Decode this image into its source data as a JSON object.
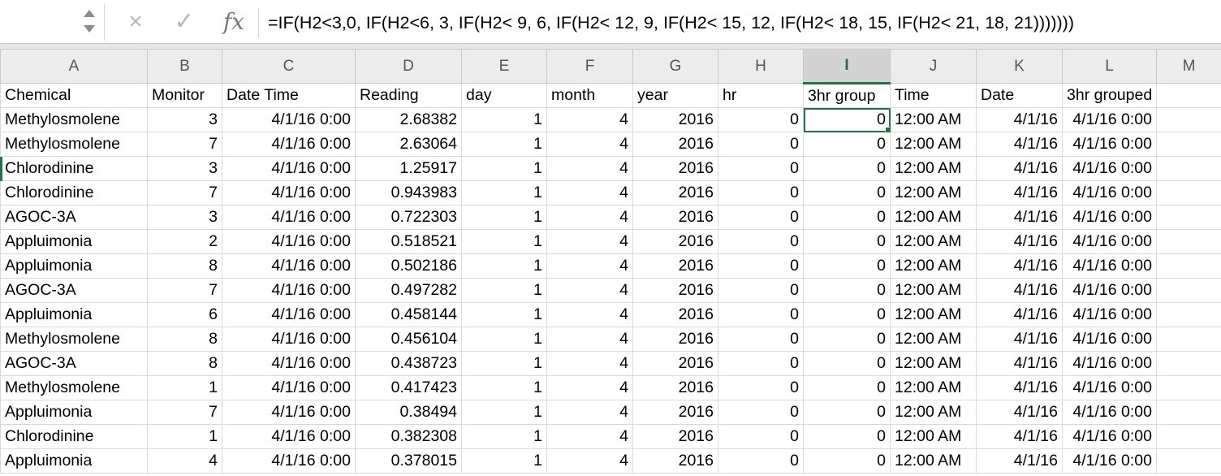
{
  "formula_bar": {
    "name_box": "",
    "formula": "=IF(H2<3,0, IF(H2<6, 3, IF(H2< 9, 6,  IF(H2< 12, 9,  IF(H2< 15, 12,  IF(H2< 18, 15,  IF(H2< 21, 18,  21)))))))",
    "cancel_icon": "×",
    "enter_icon": "✓",
    "fx_label": "fx"
  },
  "columns": [
    "A",
    "B",
    "C",
    "D",
    "E",
    "F",
    "G",
    "H",
    "I",
    "J",
    "K",
    "L",
    "M"
  ],
  "selected_column": "I",
  "header_row": [
    "Chemical",
    "Monitor",
    "Date Time",
    "Reading",
    "day",
    "month",
    "year",
    "hr",
    "3hr group",
    "Time",
    "Date",
    "3hr grouped",
    ""
  ],
  "rows": [
    [
      "Methylosmolene",
      "3",
      "4/1/16 0:00",
      "2.68382",
      "1",
      "4",
      "2016",
      "0",
      "0",
      "12:00 AM",
      "4/1/16",
      "4/1/16 0:00",
      ""
    ],
    [
      "Methylosmolene",
      "7",
      "4/1/16 0:00",
      "2.63064",
      "1",
      "4",
      "2016",
      "0",
      "0",
      "12:00 AM",
      "4/1/16",
      "4/1/16 0:00",
      ""
    ],
    [
      "Chlorodinine",
      "3",
      "4/1/16 0:00",
      "1.25917",
      "1",
      "4",
      "2016",
      "0",
      "0",
      "12:00 AM",
      "4/1/16",
      "4/1/16 0:00",
      ""
    ],
    [
      "Chlorodinine",
      "7",
      "4/1/16 0:00",
      "0.943983",
      "1",
      "4",
      "2016",
      "0",
      "0",
      "12:00 AM",
      "4/1/16",
      "4/1/16 0:00",
      ""
    ],
    [
      "AGOC-3A",
      "3",
      "4/1/16 0:00",
      "0.722303",
      "1",
      "4",
      "2016",
      "0",
      "0",
      "12:00 AM",
      "4/1/16",
      "4/1/16 0:00",
      ""
    ],
    [
      "Appluimonia",
      "2",
      "4/1/16 0:00",
      "0.518521",
      "1",
      "4",
      "2016",
      "0",
      "0",
      "12:00 AM",
      "4/1/16",
      "4/1/16 0:00",
      ""
    ],
    [
      "Appluimonia",
      "8",
      "4/1/16 0:00",
      "0.502186",
      "1",
      "4",
      "2016",
      "0",
      "0",
      "12:00 AM",
      "4/1/16",
      "4/1/16 0:00",
      ""
    ],
    [
      "AGOC-3A",
      "7",
      "4/1/16 0:00",
      "0.497282",
      "1",
      "4",
      "2016",
      "0",
      "0",
      "12:00 AM",
      "4/1/16",
      "4/1/16 0:00",
      ""
    ],
    [
      "Appluimonia",
      "6",
      "4/1/16 0:00",
      "0.458144",
      "1",
      "4",
      "2016",
      "0",
      "0",
      "12:00 AM",
      "4/1/16",
      "4/1/16 0:00",
      ""
    ],
    [
      "Methylosmolene",
      "8",
      "4/1/16 0:00",
      "0.456104",
      "1",
      "4",
      "2016",
      "0",
      "0",
      "12:00 AM",
      "4/1/16",
      "4/1/16 0:00",
      ""
    ],
    [
      "AGOC-3A",
      "8",
      "4/1/16 0:00",
      "0.438723",
      "1",
      "4",
      "2016",
      "0",
      "0",
      "12:00 AM",
      "4/1/16",
      "4/1/16 0:00",
      ""
    ],
    [
      "Methylosmolene",
      "1",
      "4/1/16 0:00",
      "0.417423",
      "1",
      "4",
      "2016",
      "0",
      "0",
      "12:00 AM",
      "4/1/16",
      "4/1/16 0:00",
      ""
    ],
    [
      "Appluimonia",
      "7",
      "4/1/16 0:00",
      "0.38494",
      "1",
      "4",
      "2016",
      "0",
      "0",
      "12:00 AM",
      "4/1/16",
      "4/1/16 0:00",
      ""
    ],
    [
      "Chlorodinine",
      "1",
      "4/1/16 0:00",
      "0.382308",
      "1",
      "4",
      "2016",
      "0",
      "0",
      "12:00 AM",
      "4/1/16",
      "4/1/16 0:00",
      ""
    ],
    [
      "Appluimonia",
      "4",
      "4/1/16 0:00",
      "0.378015",
      "1",
      "4",
      "2016",
      "0",
      "0",
      "12:00 AM",
      "4/1/16",
      "4/1/16 0:00",
      ""
    ]
  ],
  "colors": {
    "accent": "#217346",
    "header_bg": "#ececec",
    "grid_line": "#d9d9d9"
  }
}
